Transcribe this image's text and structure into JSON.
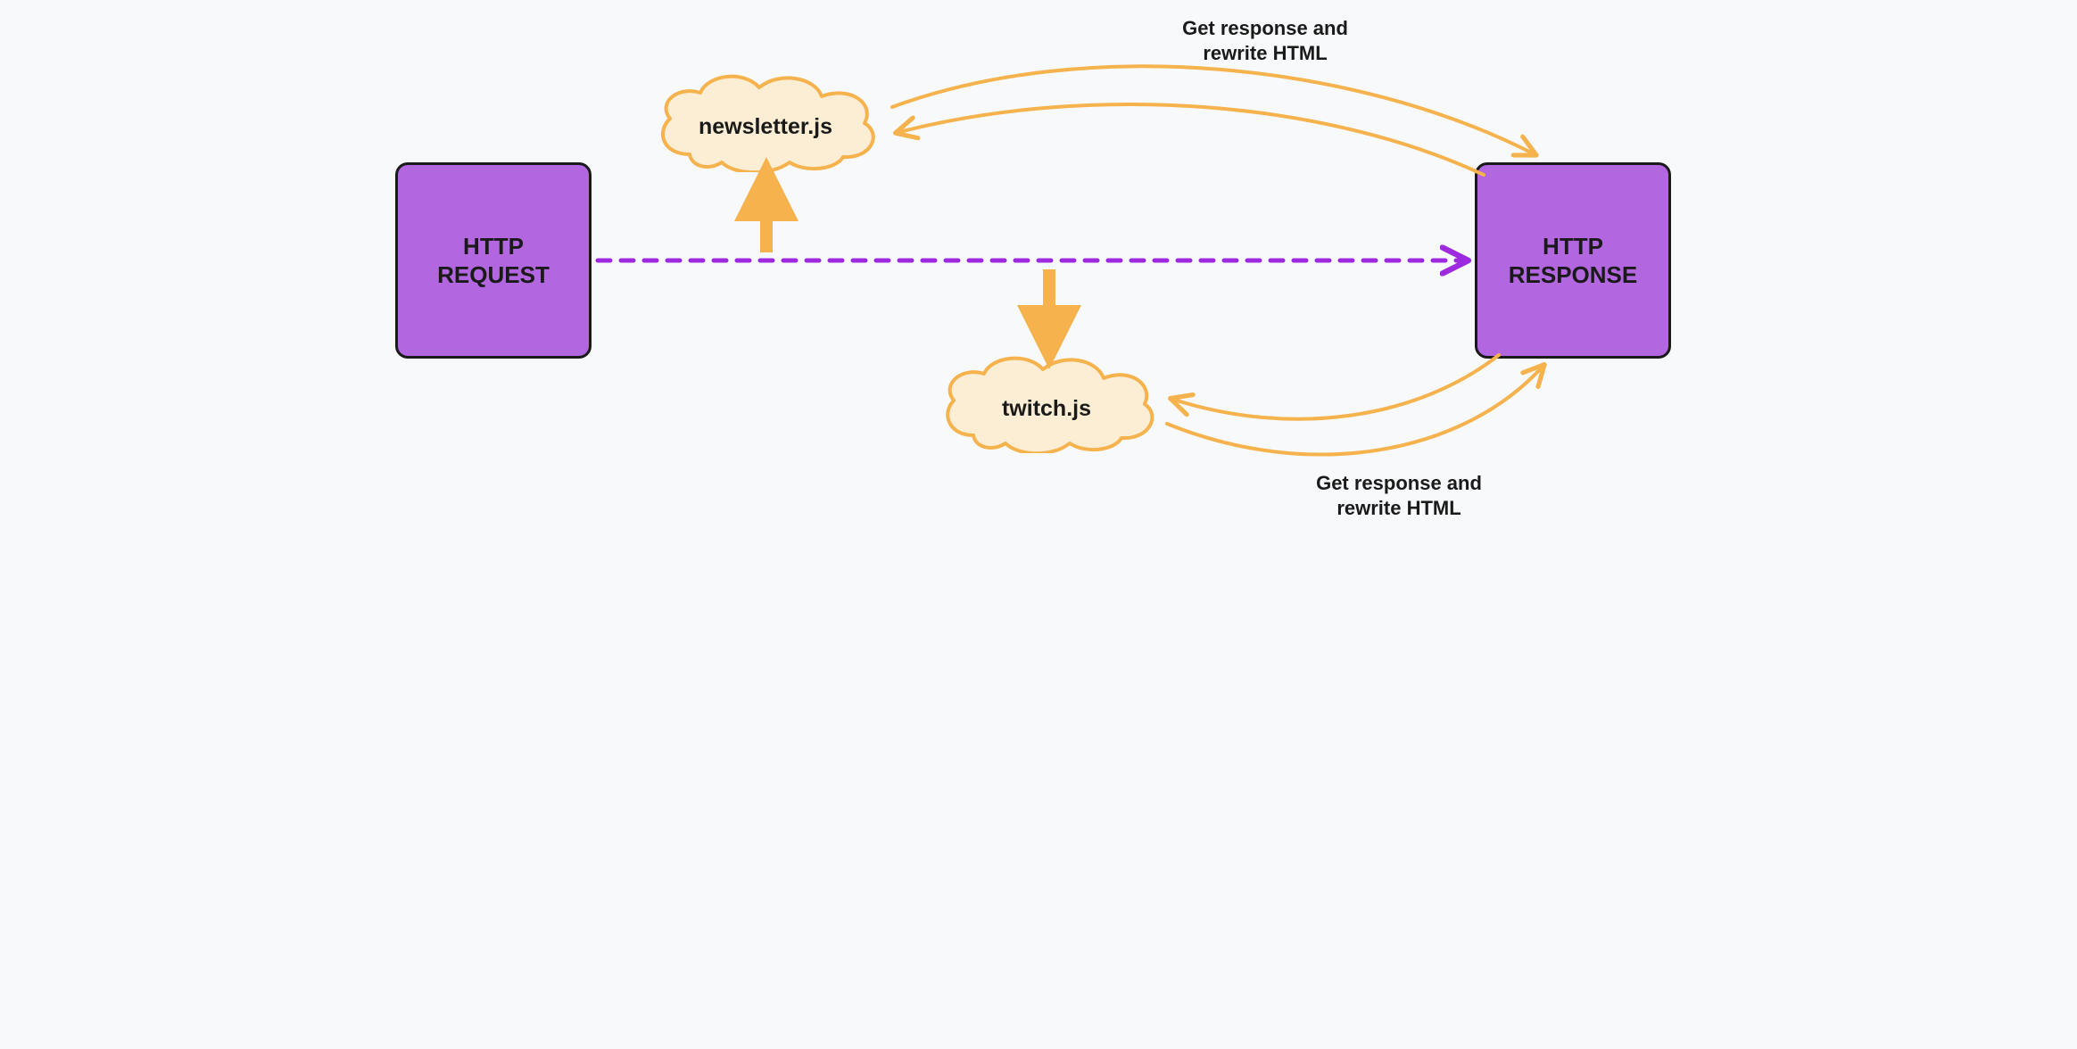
{
  "boxes": {
    "request": "HTTP\nREQUEST",
    "response": "HTTP\nRESPONSE"
  },
  "clouds": {
    "newsletter": "newsletter.js",
    "twitch": "twitch.js"
  },
  "annotations": {
    "top": "Get response and\nrewrite HTML",
    "bottom": "Get response and\nrewrite HTML"
  },
  "colors": {
    "purple_fill": "#b266e0",
    "purple_stroke": "#9d2adf",
    "orange": "#f6b24c",
    "cloud_fill": "#fbeed4",
    "bg": "#f7f9fb",
    "text": "#1a1a1a"
  }
}
